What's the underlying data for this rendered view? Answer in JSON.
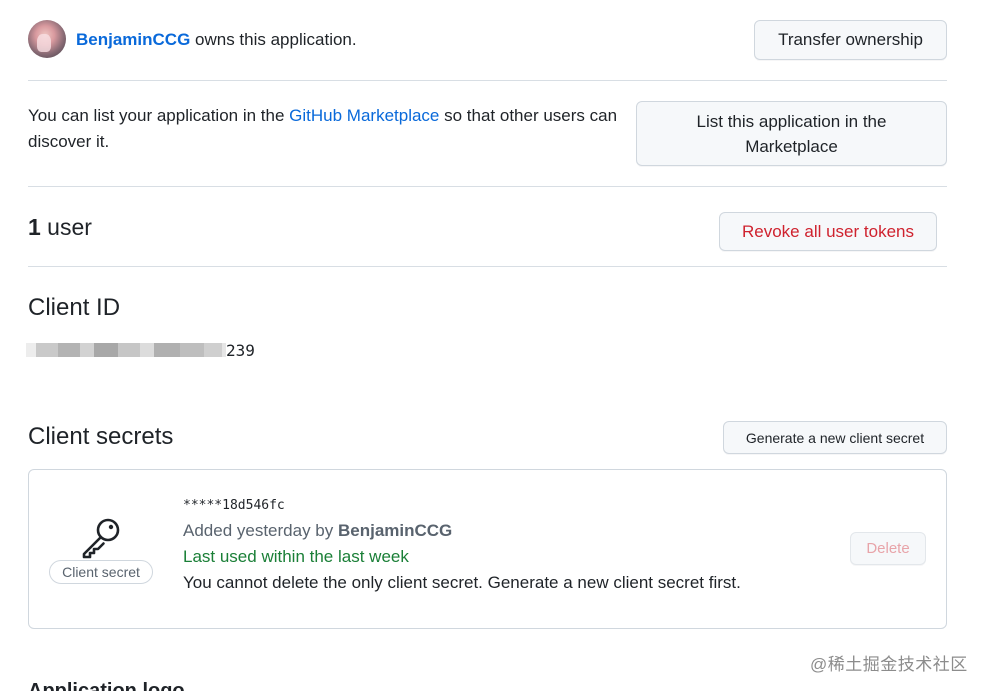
{
  "owner": {
    "username": "BenjaminCCG",
    "suffix": " owns this application.",
    "transfer_label": "Transfer ownership"
  },
  "marketplace": {
    "prefix": "You can list your application in the ",
    "link": "GitHub Marketplace",
    "suffix": " so that other users can discover it.",
    "button_label": "List this application in the Marketplace"
  },
  "users": {
    "count": "1",
    "label": " user",
    "revoke_label": "Revoke all user tokens"
  },
  "client_id": {
    "heading": "Client ID",
    "visible_suffix": "239"
  },
  "client_secrets": {
    "heading": "Client secrets",
    "generate_label": "Generate a new client secret",
    "secret": {
      "badge": "Client secret",
      "masked": "*****18d546fc",
      "added_prefix": "Added yesterday by ",
      "added_by": "BenjaminCCG",
      "last_used": "Last used within the last week",
      "note": "You cannot delete the only client secret. Generate a new client secret first.",
      "delete_label": "Delete",
      "icon": "key-icon"
    }
  },
  "application_logo": {
    "heading": "Application logo"
  },
  "watermark": "@稀土掘金技术社区",
  "colors": {
    "link": "#0969da",
    "danger": "#cf222e",
    "success": "#1a7f37",
    "muted": "#59636e",
    "border": "#d0d7de"
  }
}
